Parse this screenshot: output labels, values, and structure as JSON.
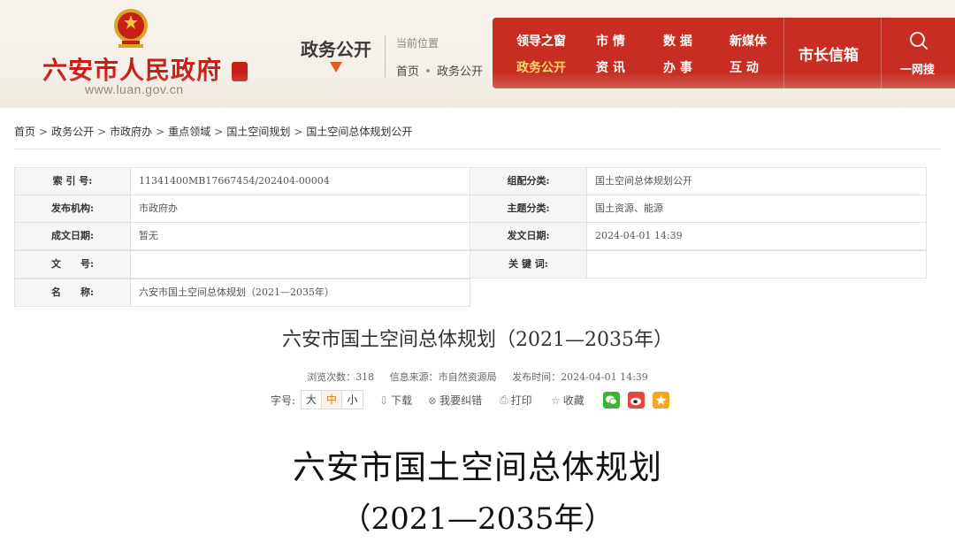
{
  "header": {
    "site_name": "六安市人民政府",
    "site_url": "www.luan.gov.cn",
    "section_title": "政务公开",
    "position_label": "当前位置",
    "position_path": [
      "首页",
      "政务公开"
    ],
    "nav": {
      "col1": [
        "领导之窗",
        "政务公开"
      ],
      "col2": [
        "市  情",
        "资  讯"
      ],
      "col3": [
        "数  据",
        "办  事"
      ],
      "col4": [
        "新媒体",
        "互  动"
      ],
      "active": "政务公开",
      "mayor_mailbox": "市长信箱",
      "search_label": "一网搜",
      "search_icon": "search-icon"
    },
    "colors": {
      "brand_red": "#c71f16",
      "nav_bg": "#c72e21",
      "active_nav": "#ffd86b",
      "arrow": "#e65a1a"
    }
  },
  "breadcrumb": [
    "首页",
    "政务公开",
    "市政府办",
    "重点领域",
    "国土空间规划",
    "国土空间总体规划公开"
  ],
  "meta": {
    "index_label": "索 引 号:",
    "index_value": "11341400MB17667454/202404-00004",
    "category_label": "组配分类:",
    "category_value": "国土空间总体规划公开",
    "publisher_label": "发布机构:",
    "publisher_value": "市政府办",
    "topic_label": "主题分类:",
    "topic_value": "国土资源、能源",
    "created_label": "成文日期:",
    "created_value": "暂无",
    "published_label": "发文日期:",
    "published_value": "2024-04-01 14:39",
    "docno_label": "文　　号:",
    "docno_value": "",
    "keywords_label": "关 键 词:",
    "keywords_value": "",
    "name_label": "名　　称:",
    "name_value": "六安市国土空间总体规划（2021—2035年）"
  },
  "article": {
    "title": "六安市国土空间总体规划（2021—2035年）",
    "views_label": "浏览次数：",
    "views": "318",
    "source_label": "信息来源：",
    "source": "市自然资源局",
    "time_label": "发布时间：",
    "time": "2024-04-01 14:39",
    "font_size_label": "字号:",
    "font_sizes": [
      "大",
      "中",
      "小"
    ],
    "current_font_size": "中",
    "download": "下载",
    "report_error": "我要纠错",
    "print": "打印",
    "favorite": "收藏",
    "share_icons": [
      "wechat-icon",
      "weibo-icon",
      "favorite-star-icon"
    ],
    "body_title": "六安市国土空间总体规划",
    "body_subtitle": "（2021—2035年）"
  }
}
